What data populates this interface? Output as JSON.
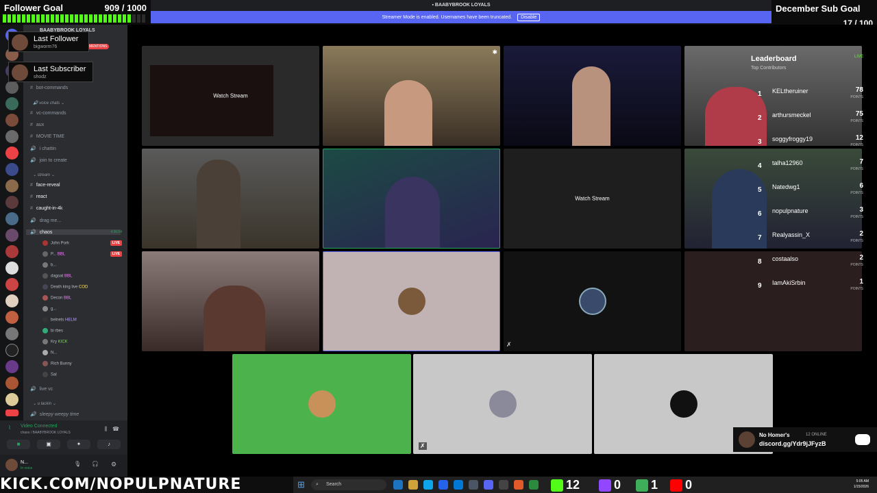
{
  "follower_goal": {
    "label": "Follower Goal",
    "count": "909 / 1000",
    "progress": 0.909
  },
  "sub_goal": {
    "label": "December Sub Goal",
    "count": "17 / 100",
    "progress": 0.17
  },
  "window_title": "BAABYBROOK LOYALS",
  "streamer_mode": {
    "text": "Streamer Mode is enabled. Usernames have been truncated.",
    "button": "Disable"
  },
  "last_follower": {
    "title": "Last Follower",
    "name": "bigworm76"
  },
  "last_subscriber": {
    "title": "Last Subscriber",
    "name": "shodz"
  },
  "server": {
    "name": "BAABYBROOK LOYALS",
    "new_mentions": "NEW MENTIONS",
    "channels_top": [
      "bot-commands"
    ],
    "voice_category": "voice chats",
    "voice_channels": [
      "vc-commands",
      "aux",
      "MOVIE TIME",
      "i chattin",
      "join to create"
    ],
    "stream_category": "stream",
    "stream_channels": [
      "face-reveal",
      "react",
      "caught-in-4k"
    ],
    "drag_me": "drag me...",
    "chaos": {
      "name": "chaos",
      "time": "4:36:54"
    },
    "chaos_users": [
      {
        "name": "John Pork",
        "live": "LIVE"
      },
      {
        "name": "P...",
        "tag": "BBL",
        "live": "LIVE"
      },
      {
        "name": "b..."
      },
      {
        "name": "dagoat",
        "tag": "BBL"
      },
      {
        "name": "Death king live",
        "tag": "COD"
      },
      {
        "name": "Decon",
        "tag": "BBL"
      },
      {
        "name": "g..."
      },
      {
        "name": "belnets",
        "tag": "HELM"
      },
      {
        "name": "bi rbes"
      },
      {
        "name": "Kry",
        "tag": "KICK"
      },
      {
        "name": "N..."
      },
      {
        "name": "Rich Bunny"
      },
      {
        "name": "Sal"
      }
    ],
    "live_vc": "live vc",
    "u_lackin": "u lackin",
    "sleepy": "sleepy weepy time"
  },
  "voice_panel": {
    "status": "Video Connected",
    "location": "chaos / BAABYBROOK LOYALS"
  },
  "user": {
    "name": "N...",
    "status": "In voice"
  },
  "tiles": {
    "watch_stream": "Watch Stream"
  },
  "leaderboard": {
    "title": "Leaderboard",
    "subtitle": "Top Contributors",
    "live": "LIVE",
    "points_label": "POINTS",
    "rows": [
      {
        "rank": "1",
        "name": "KELtheruiner",
        "points": "78"
      },
      {
        "rank": "2",
        "name": "arthursmeckel",
        "points": "75"
      },
      {
        "rank": "3",
        "name": "soggyfroggy19",
        "points": "12"
      },
      {
        "rank": "4",
        "name": "talha12960",
        "points": "7"
      },
      {
        "rank": "5",
        "name": "Natedwg1",
        "points": "6"
      },
      {
        "rank": "6",
        "name": "nopulpnature",
        "points": "3"
      },
      {
        "rank": "7",
        "name": "Realyassin_X",
        "points": "2"
      },
      {
        "rank": "8",
        "name": "costaalso",
        "points": "2"
      },
      {
        "rank": "9",
        "name": "IamAkiSrbin",
        "points": "1"
      }
    ]
  },
  "promo": {
    "name": "No Homer's",
    "online": "12 ONLINE",
    "url": "discord.gg/Ydr9jJFyzB"
  },
  "bottom": {
    "kick_url": "KICK.COM/NOPULPNATURE",
    "search": "Search",
    "kick_count": "12",
    "twitch_count": "0",
    "rumble_count": "1",
    "youtube_count": "0",
    "time": "5:05 AM",
    "date": "1/15/2026"
  },
  "colors": {
    "kick_green": "#53fc18",
    "discord_blurple": "#5865f2",
    "live_red": "#ed4245"
  }
}
